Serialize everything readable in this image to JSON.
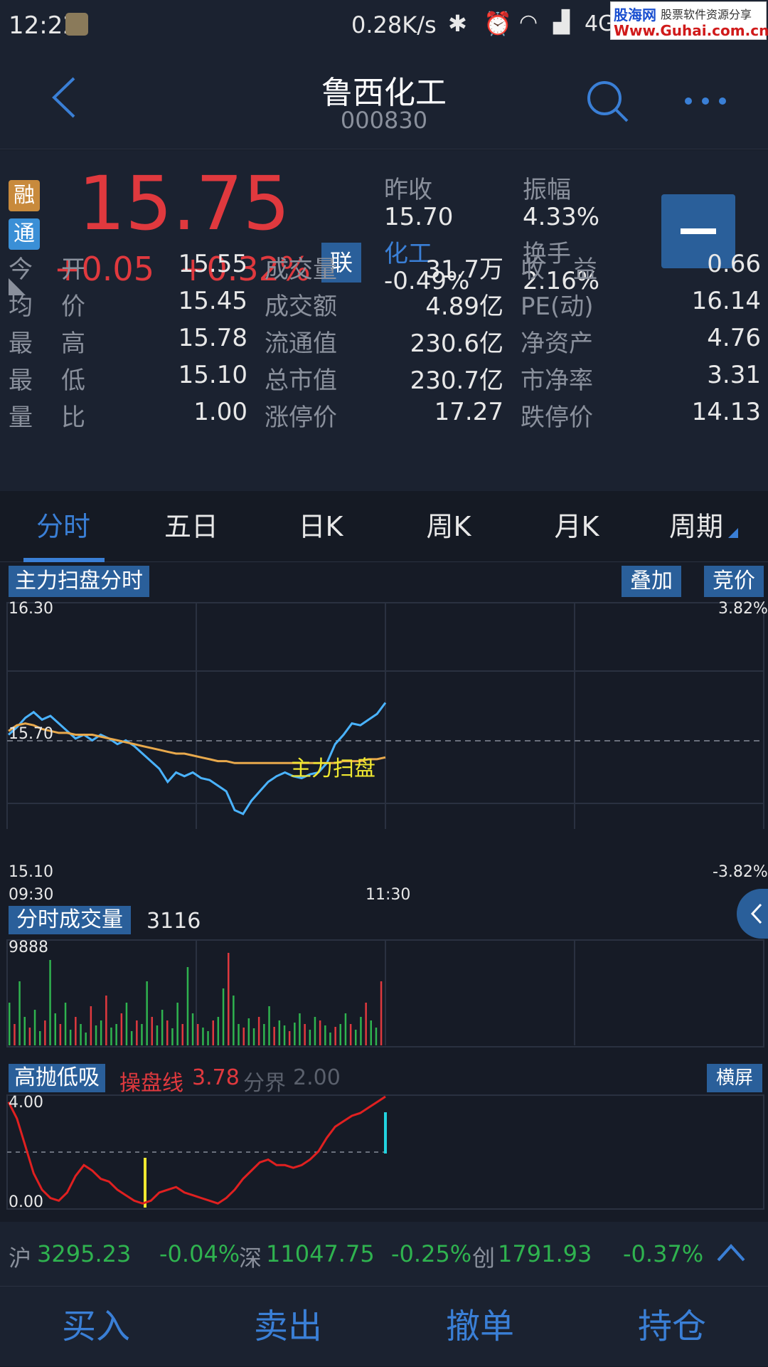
{
  "status_bar": {
    "time": "12:22",
    "speed": "0.28K/s",
    "network": "4G",
    "watermark_top": "股海网",
    "watermark_top2": "股票软件资源分享",
    "watermark_url": "Www.Guhai.com.cn"
  },
  "header": {
    "title": "鲁西化工",
    "code": "000830"
  },
  "quote": {
    "price": "15.75",
    "change": "+0.05",
    "change_pct": "+0.32%",
    "badge_rong": "融",
    "badge_tong": "通",
    "badge_lian": "联",
    "prev_close_label": "昨收",
    "prev_close": "15.70",
    "amplitude_label": "振幅",
    "amplitude": "4.33%",
    "sector_label": "化工",
    "sector_change": "-0.49%",
    "turnover_label": "换手",
    "turnover": "2.16%",
    "grid": [
      {
        "l1": "今",
        "l1b": "开",
        "v1": "15.55",
        "l2": "成交量",
        "v2": "31.7万",
        "l3": "收",
        "l3b": "益",
        "v3": "0.66"
      },
      {
        "l1": "均",
        "l1b": "价",
        "v1": "15.45",
        "l2": "成交额",
        "v2": "4.89亿",
        "l3": "PE(动)",
        "l3b": "",
        "v3": "16.14"
      },
      {
        "l1": "最",
        "l1b": "高",
        "v1": "15.78",
        "l2": "流通值",
        "v2": "230.6亿",
        "l3": "净资产",
        "l3b": "",
        "v3": "4.76"
      },
      {
        "l1": "最",
        "l1b": "低",
        "v1": "15.10",
        "l2": "总市值",
        "v2": "230.7亿",
        "l3": "市净率",
        "l3b": "",
        "v3": "3.31"
      },
      {
        "l1": "量",
        "l1b": "比",
        "v1": "1.00",
        "l2": "涨停价",
        "v2": "17.27",
        "l3": "跌停价",
        "l3b": "",
        "v3": "14.13"
      }
    ]
  },
  "tabs": [
    "分时",
    "五日",
    "日K",
    "周K",
    "月K",
    "周期"
  ],
  "chart": {
    "panel_title": "主力扫盘分时",
    "overlay_btn": "叠加",
    "bid_btn": "竞价",
    "y_top": "16.30",
    "y_mid": "15.70",
    "y_bottom": "15.10",
    "pct_top": "3.82%",
    "pct_bottom": "-3.82%",
    "time_start": "09:30",
    "time_mid": "11:30",
    "annotation": "主力扫盘",
    "vol_title": "分时成交量",
    "vol_value": "3116",
    "vol_max": "9888",
    "ind_title": "高抛低吸",
    "ind_line_label": "操盘线",
    "ind_line_value": "3.78",
    "ind_div_label": "分界",
    "ind_div_value": "2.00",
    "ind_top": "4.00",
    "ind_bottom": "0.00",
    "landscape_btn": "横屏"
  },
  "chart_data": {
    "type": "line",
    "series": [
      {
        "values": [
          15.6,
          15.64,
          15.69,
          15.72,
          15.68,
          15.7,
          15.66,
          15.62,
          15.58,
          15.6,
          15.57,
          15.6,
          15.58,
          15.55,
          15.57,
          15.54,
          15.5,
          15.46,
          15.42,
          15.35,
          15.4,
          15.38,
          15.4,
          15.37,
          15.36,
          15.33,
          15.3,
          15.2,
          15.18,
          15.25,
          15.3,
          15.35,
          15.38,
          15.4,
          15.38,
          15.37,
          15.39,
          15.4,
          15.45,
          15.55,
          15.6,
          15.66,
          15.65,
          15.68,
          15.71,
          15.77
        ]
      },
      {
        "values": [
          15.62,
          15.65,
          15.66,
          15.65,
          15.63,
          15.62,
          15.61,
          15.61,
          15.6,
          15.6,
          15.6,
          15.59,
          15.58,
          15.57,
          15.56,
          15.55,
          15.54,
          15.53,
          15.52,
          15.51,
          15.5,
          15.5,
          15.49,
          15.48,
          15.47,
          15.46,
          15.46,
          15.45,
          15.45,
          15.45,
          15.45,
          15.45,
          15.45,
          15.45,
          15.45,
          15.45,
          15.45,
          15.45,
          15.45,
          15.45,
          15.46,
          15.46,
          15.46,
          15.47,
          15.47,
          15.48
        ]
      }
    ]
  },
  "market": [
    {
      "name": "沪",
      "value": "3295.23",
      "pct": "-0.04%"
    },
    {
      "name": "深",
      "value": "11047.75",
      "pct": "-0.25%"
    },
    {
      "name": "创",
      "value": "1791.93",
      "pct": "-0.37%"
    }
  ],
  "bottom": [
    "买入",
    "卖出",
    "撤单",
    "持仓"
  ]
}
